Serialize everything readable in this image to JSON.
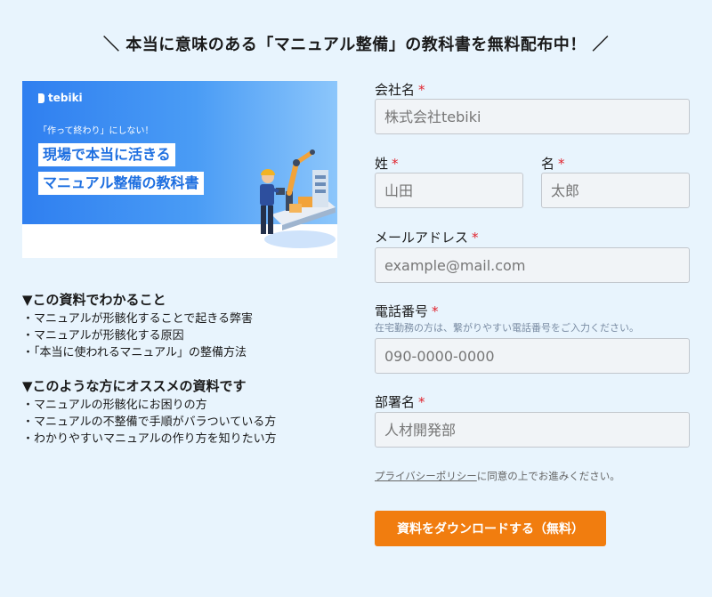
{
  "headline": "＼ 本当に意味のある「マニュアル整備」の教科書を無料配布中！ ／",
  "banner": {
    "logo_text": "tebiki",
    "tagline": "「作って終わり」にしない！",
    "title_line1": "現場で本当に活きる",
    "title_line2": "マニュアル整備の教科書"
  },
  "info_sections": [
    {
      "heading": "▼この資料でわかること",
      "items": [
        "・マニュアルが形骸化することで起きる弊害",
        "・マニュアルが形骸化する原因",
        "・「本当に使われるマニュアル」の整備方法"
      ]
    },
    {
      "heading": "▼このような方にオススメの資料です",
      "items": [
        "・マニュアルの形骸化にお困りの方",
        "・マニュアルの不整備で手順がバラついている方",
        "・わかりやすいマニュアルの作り方を知りたい方"
      ]
    }
  ],
  "form": {
    "required_mark": "*",
    "company": {
      "label": "会社名",
      "placeholder": "株式会社tebiki"
    },
    "last_name": {
      "label": "姓",
      "placeholder": "山田"
    },
    "first_name": {
      "label": "名",
      "placeholder": "太郎"
    },
    "email": {
      "label": "メールアドレス",
      "placeholder": "example@mail.com"
    },
    "phone": {
      "label": "電話番号",
      "note": "在宅勤務の方は、繋がりやすい電話番号をご入力ください。",
      "placeholder": "090-0000-0000"
    },
    "department": {
      "label": "部署名",
      "placeholder": "人材開発部"
    },
    "privacy_link": "プライバシーポリシー",
    "privacy_text": "に同意の上でお進みください。",
    "submit_label": "資料をダウンロードする（無料）"
  },
  "colors": {
    "background": "#e8f4fd",
    "cta": "#f17d0f",
    "required": "#e0242e",
    "banner_blue": "#2f7ff0"
  }
}
